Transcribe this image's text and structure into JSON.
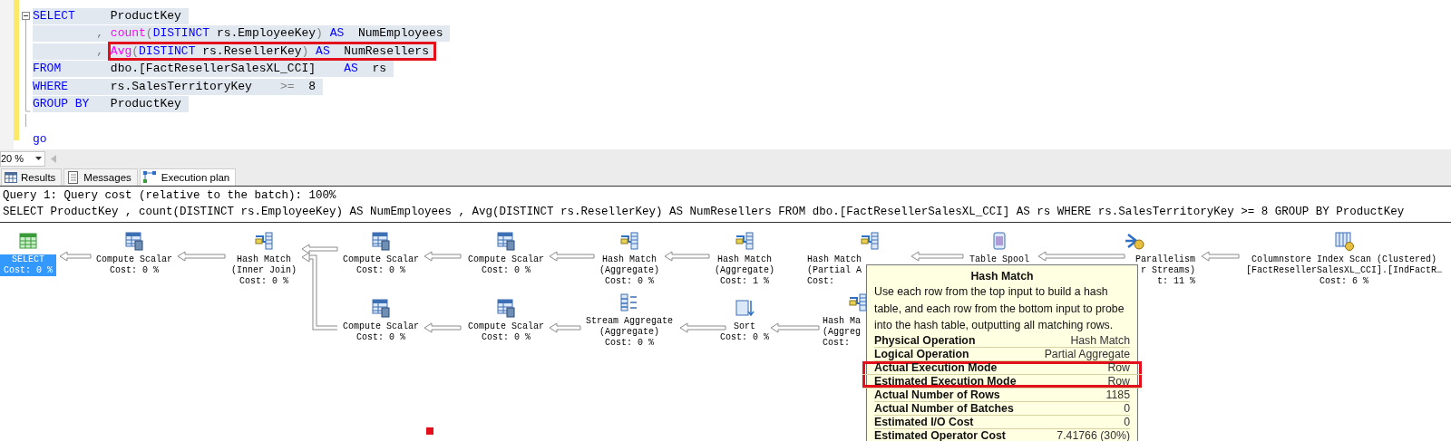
{
  "editor": {
    "lines": [
      {
        "selected": true,
        "highlighted": false,
        "tokens": [
          {
            "kind": "keyword",
            "text": "SELECT"
          },
          {
            "kind": "plain",
            "text": "     ProductKey"
          }
        ]
      },
      {
        "selected": true,
        "highlighted": false,
        "tokens": [
          {
            "kind": "punct",
            "text": "         , "
          },
          {
            "kind": "function",
            "text": "count"
          },
          {
            "kind": "punct",
            "text": "("
          },
          {
            "kind": "keyword",
            "text": "DISTINCT"
          },
          {
            "kind": "plain",
            "text": " rs.EmployeeKey"
          },
          {
            "kind": "punct",
            "text": ")"
          },
          {
            "kind": "keyword",
            "text": " AS"
          },
          {
            "kind": "plain",
            "text": "  NumEmployees"
          }
        ]
      },
      {
        "selected": true,
        "highlighted": true,
        "tokens": [
          {
            "kind": "punct",
            "text": "         , "
          },
          {
            "kind": "function",
            "text": "Avg"
          },
          {
            "kind": "punct",
            "text": "("
          },
          {
            "kind": "keyword",
            "text": "DISTINCT"
          },
          {
            "kind": "plain",
            "text": " rs.ResellerKey"
          },
          {
            "kind": "punct",
            "text": ")"
          },
          {
            "kind": "keyword",
            "text": " AS"
          },
          {
            "kind": "plain",
            "text": "  NumResellers"
          }
        ]
      },
      {
        "selected": true,
        "highlighted": false,
        "tokens": [
          {
            "kind": "keyword",
            "text": "FROM"
          },
          {
            "kind": "plain",
            "text": "       dbo.[FactResellerSalesXL_CCI]    "
          },
          {
            "kind": "keyword",
            "text": "AS"
          },
          {
            "kind": "plain",
            "text": "  rs"
          }
        ]
      },
      {
        "selected": true,
        "highlighted": false,
        "tokens": [
          {
            "kind": "keyword",
            "text": "WHERE"
          },
          {
            "kind": "plain",
            "text": "      rs.SalesTerritoryKey    "
          },
          {
            "kind": "punct",
            "text": ">="
          },
          {
            "kind": "plain",
            "text": "  8"
          }
        ]
      },
      {
        "selected": true,
        "highlighted": false,
        "tokens": [
          {
            "kind": "keyword",
            "text": "GROUP BY"
          },
          {
            "kind": "plain",
            "text": "   ProductKey"
          }
        ]
      },
      {
        "selected": false
      },
      {
        "selected": false,
        "highlighted": false,
        "tokens": [
          {
            "kind": "keyword",
            "text": "go"
          }
        ]
      }
    ]
  },
  "zoom": {
    "value": "20 %"
  },
  "tabs": [
    {
      "label": "Results",
      "selected": false,
      "kind": "grid"
    },
    {
      "label": "Messages",
      "selected": false,
      "kind": "messages"
    },
    {
      "label": "Execution plan",
      "selected": true,
      "kind": "plan"
    }
  ],
  "plan": {
    "header": [
      "Query 1: Query cost (relative to the batch): 100%",
      "SELECT ProductKey , count(DISTINCT rs.EmployeeKey) AS NumEmployees , Avg(DISTINCT rs.ResellerKey) AS NumResellers FROM dbo.[FactResellerSalesXL_CCI] AS rs WHERE rs.SalesTerritoryKey >= 8 GROUP BY ProductKey"
    ],
    "top_row": [
      {
        "kind": "select",
        "lines": [
          "SELECT"
        ],
        "cost": "Cost: 0 %",
        "selected": true
      },
      {
        "kind": "compute",
        "lines": [
          "Compute Scalar"
        ],
        "cost": "Cost: 0 %",
        "selected": false
      },
      {
        "kind": "hash",
        "lines": [
          "Hash Match",
          "(Inner Join)"
        ],
        "cost": "Cost: 0 %",
        "selected": false
      },
      {
        "kind": "compute",
        "lines": [
          "Compute Scalar"
        ],
        "cost": "Cost: 0 %",
        "selected": false
      },
      {
        "kind": "compute",
        "lines": [
          "Compute Scalar"
        ],
        "cost": "Cost: 0 %",
        "selected": false
      },
      {
        "kind": "hash",
        "lines": [
          "Hash Match",
          "(Aggregate)"
        ],
        "cost": "Cost: 0 %",
        "selected": false
      },
      {
        "kind": "hash",
        "lines": [
          "Hash Match",
          "(Aggregate)"
        ],
        "cost": "Cost: 1 %",
        "selected": false
      },
      {
        "kind": "hash",
        "lines": [
          "Hash Match",
          "(Partial A"
        ],
        "cost": "Cost:",
        "selected": false
      },
      {
        "kind": "spool",
        "lines": [
          "Table Spool"
        ],
        "selected": false
      },
      {
        "kind": "parallelism",
        "lines": [
          "Parallelism",
          "r Streams)"
        ],
        "cost": "t: 11 %",
        "selected": false
      },
      {
        "kind": "columnstore",
        "lines": [
          "Columnstore Index Scan (Clustered)",
          "[FactResellerSalesXL_CCI].[IndFactR…"
        ],
        "cost": "Cost: 6 %",
        "selected": false
      }
    ],
    "bottom_row": [
      {
        "kind": "compute",
        "lines": [
          "Compute Scalar"
        ],
        "cost": "Cost: 0 %",
        "selected": false
      },
      {
        "kind": "compute",
        "lines": [
          "Compute Scalar"
        ],
        "cost": "Cost: 0 %",
        "selected": false
      },
      {
        "kind": "stream",
        "lines": [
          "Stream Aggregate",
          "(Aggregate)"
        ],
        "cost": "Cost: 0 %",
        "selected": false
      },
      {
        "kind": "sort",
        "lines": [
          "Sort"
        ],
        "cost": "Cost: 0 %",
        "selected": false
      },
      {
        "kind": "hash",
        "lines": [
          "Hash Ma",
          "(Aggreg"
        ],
        "cost": "Cost:",
        "selected": false
      }
    ],
    "tooltip": {
      "title": "Hash Match",
      "description": "Use each row from the top input to build a hash table, and each row from the bottom input to probe into the hash table, outputting all matching rows.",
      "rows": [
        {
          "label": "Physical Operation",
          "value": "Hash Match",
          "highlighted": false
        },
        {
          "label": "Logical Operation",
          "value": "Partial Aggregate",
          "highlighted": false
        },
        {
          "label": "Actual Execution Mode",
          "value": "Row",
          "highlighted": true
        },
        {
          "label": "Estimated Execution Mode",
          "value": "Row",
          "highlighted": true
        },
        {
          "label": "Actual Number of Rows",
          "value": "1185",
          "highlighted": false
        },
        {
          "label": "Actual Number of Batches",
          "value": "0",
          "highlighted": false
        },
        {
          "label": "Estimated I/O Cost",
          "value": "0",
          "highlighted": false
        },
        {
          "label": "Estimated Operator Cost",
          "value": "7.41766 (30%)",
          "highlighted": false
        }
      ]
    }
  }
}
